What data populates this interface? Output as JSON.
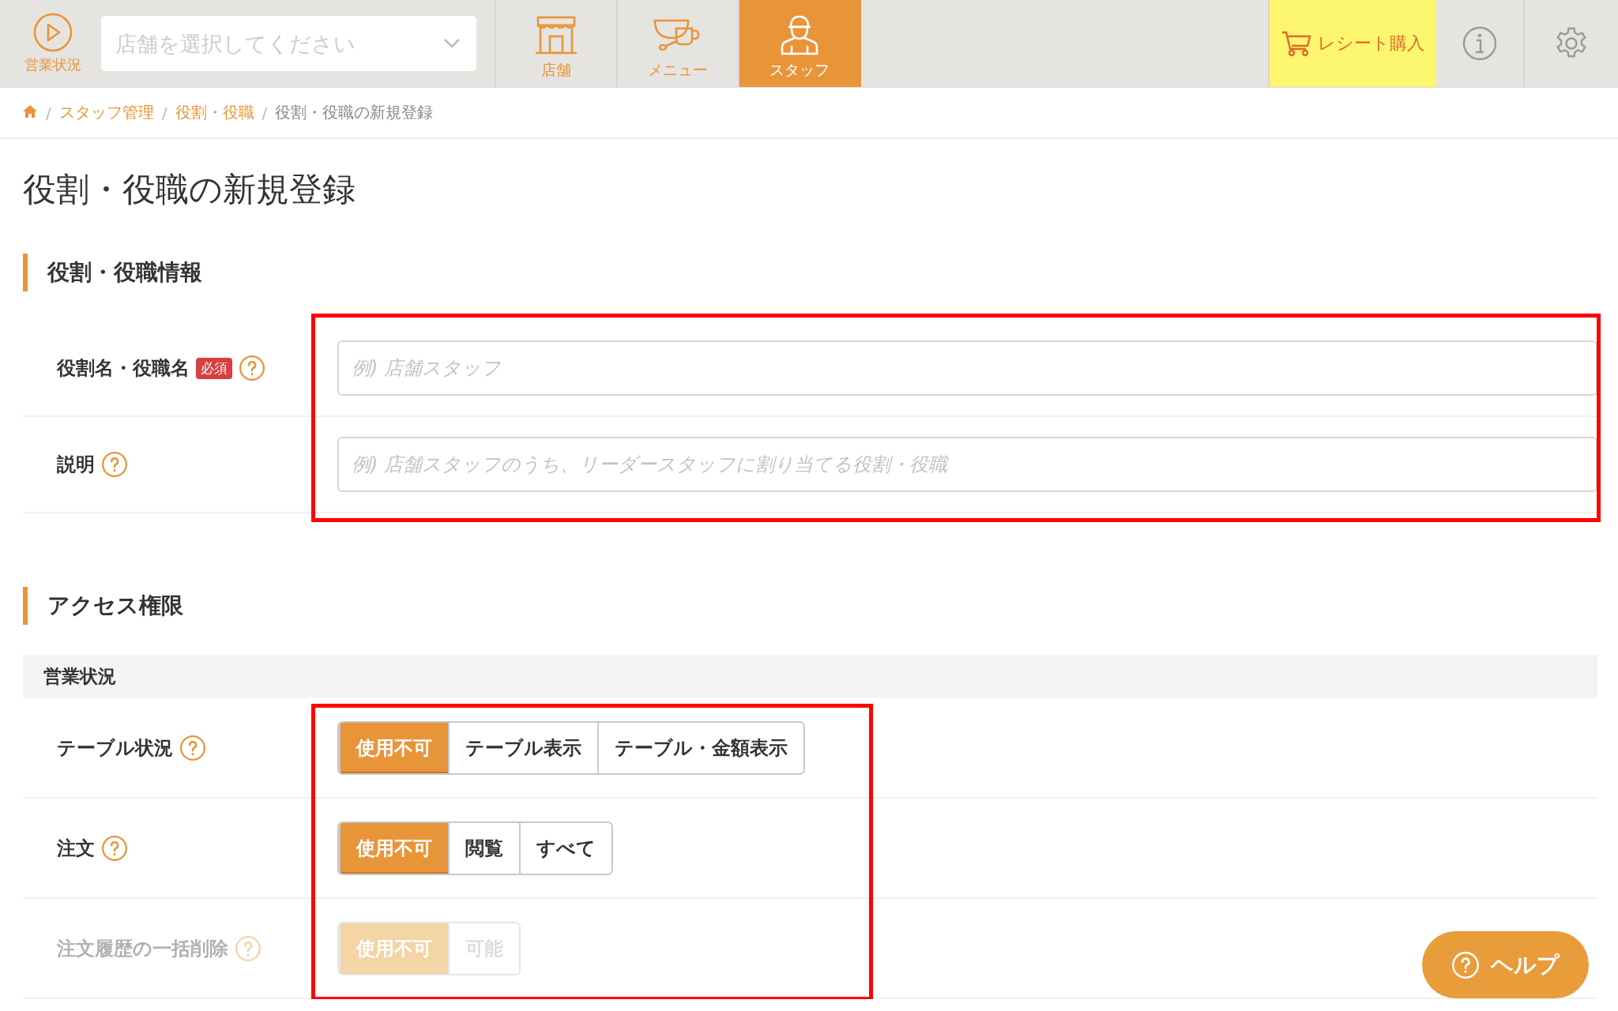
{
  "header": {
    "status_button": {
      "label": "営業状況"
    },
    "store_select": {
      "placeholder": "店舗を選択してください"
    },
    "nav_tabs": [
      {
        "label": "店舗",
        "selected": false
      },
      {
        "label": "メニュー",
        "selected": false
      },
      {
        "label": "スタッフ",
        "selected": true
      }
    ],
    "receipt_button": {
      "label": "レシート購入"
    }
  },
  "breadcrumb": [
    {
      "kind": "home"
    },
    {
      "kind": "separator",
      "label": "/"
    },
    {
      "kind": "link",
      "label": "スタッフ管理"
    },
    {
      "kind": "separator",
      "label": "/"
    },
    {
      "kind": "link",
      "label": "役割・役職"
    },
    {
      "kind": "separator",
      "label": "/"
    },
    {
      "kind": "current",
      "label": "役割・役職の新規登録"
    }
  ],
  "page_title": "役割・役職の新規登録",
  "sections": [
    {
      "heading": "役割・役職情報",
      "highlighted": true,
      "groups": [
        {
          "fields": [
            {
              "kind": "text",
              "label": "役割名・役職名",
              "badge": "必須",
              "placeholder": "例) 店舗スタッフ"
            },
            {
              "kind": "text",
              "label": "説明",
              "placeholder": "例) 店舗スタッフのうち、リーダースタッフに割り当てる役割・役職"
            }
          ]
        }
      ]
    },
    {
      "heading": "アクセス権限",
      "highlighted": true,
      "groups": [
        {
          "title": "営業状況",
          "fields": [
            {
              "kind": "segmented",
              "label": "テーブル状況",
              "disabled": false,
              "options": [
                {
                  "label": "使用不可",
                  "selected": true
                },
                {
                  "label": "テーブル表示",
                  "selected": false
                },
                {
                  "label": "テーブル・金額表示",
                  "selected": false
                }
              ]
            },
            {
              "kind": "segmented",
              "label": "注文",
              "disabled": false,
              "options": [
                {
                  "label": "使用不可",
                  "selected": true
                },
                {
                  "label": "閲覧",
                  "selected": false
                },
                {
                  "label": "すべて",
                  "selected": false
                }
              ]
            },
            {
              "kind": "segmented",
              "label": "注文履歴の一括削除",
              "disabled": true,
              "options": [
                {
                  "label": "使用不可",
                  "selected": true
                },
                {
                  "label": "可能",
                  "selected": false
                }
              ]
            }
          ]
        }
      ]
    }
  ],
  "help_button": {
    "label": "ヘルプ"
  }
}
